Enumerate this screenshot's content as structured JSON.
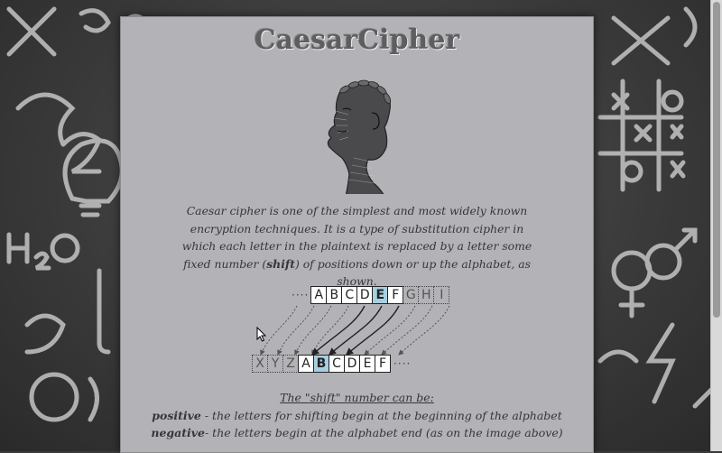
{
  "page": {
    "title": "CaesarCipher",
    "intro": {
      "part1": "Caesar cipher is one of the simplest and most widely known encryption techniques. It is a type of substitution cipher in which each letter in the plaintext is replaced by a letter some fixed number (",
      "shift_word": "shift",
      "part2": ") of positions down or up the alphabet, as shown."
    },
    "diagram": {
      "top_row": [
        "A",
        "B",
        "C",
        "D",
        "E",
        "F",
        "G",
        "H",
        "I"
      ],
      "top_highlight": "E",
      "bottom_row": [
        "X",
        "Y",
        "Z",
        "A",
        "B",
        "C",
        "D",
        "E",
        "F"
      ],
      "bottom_highlight": "B",
      "ellipsis": "····"
    },
    "shift_info": {
      "heading": "The \"shift\" number can be:",
      "positive_term": "positive",
      "positive_desc": " - the letters for shifting begin at the beginning of the alphabet",
      "negative_term": "negative",
      "negative_desc": "- the letters begin at the alphabet end (as on the image above)"
    }
  },
  "colors": {
    "panel": "#b3b2b6",
    "highlight": "#a6cfe0",
    "text": "#36363a",
    "background": "#3a3a3a"
  }
}
